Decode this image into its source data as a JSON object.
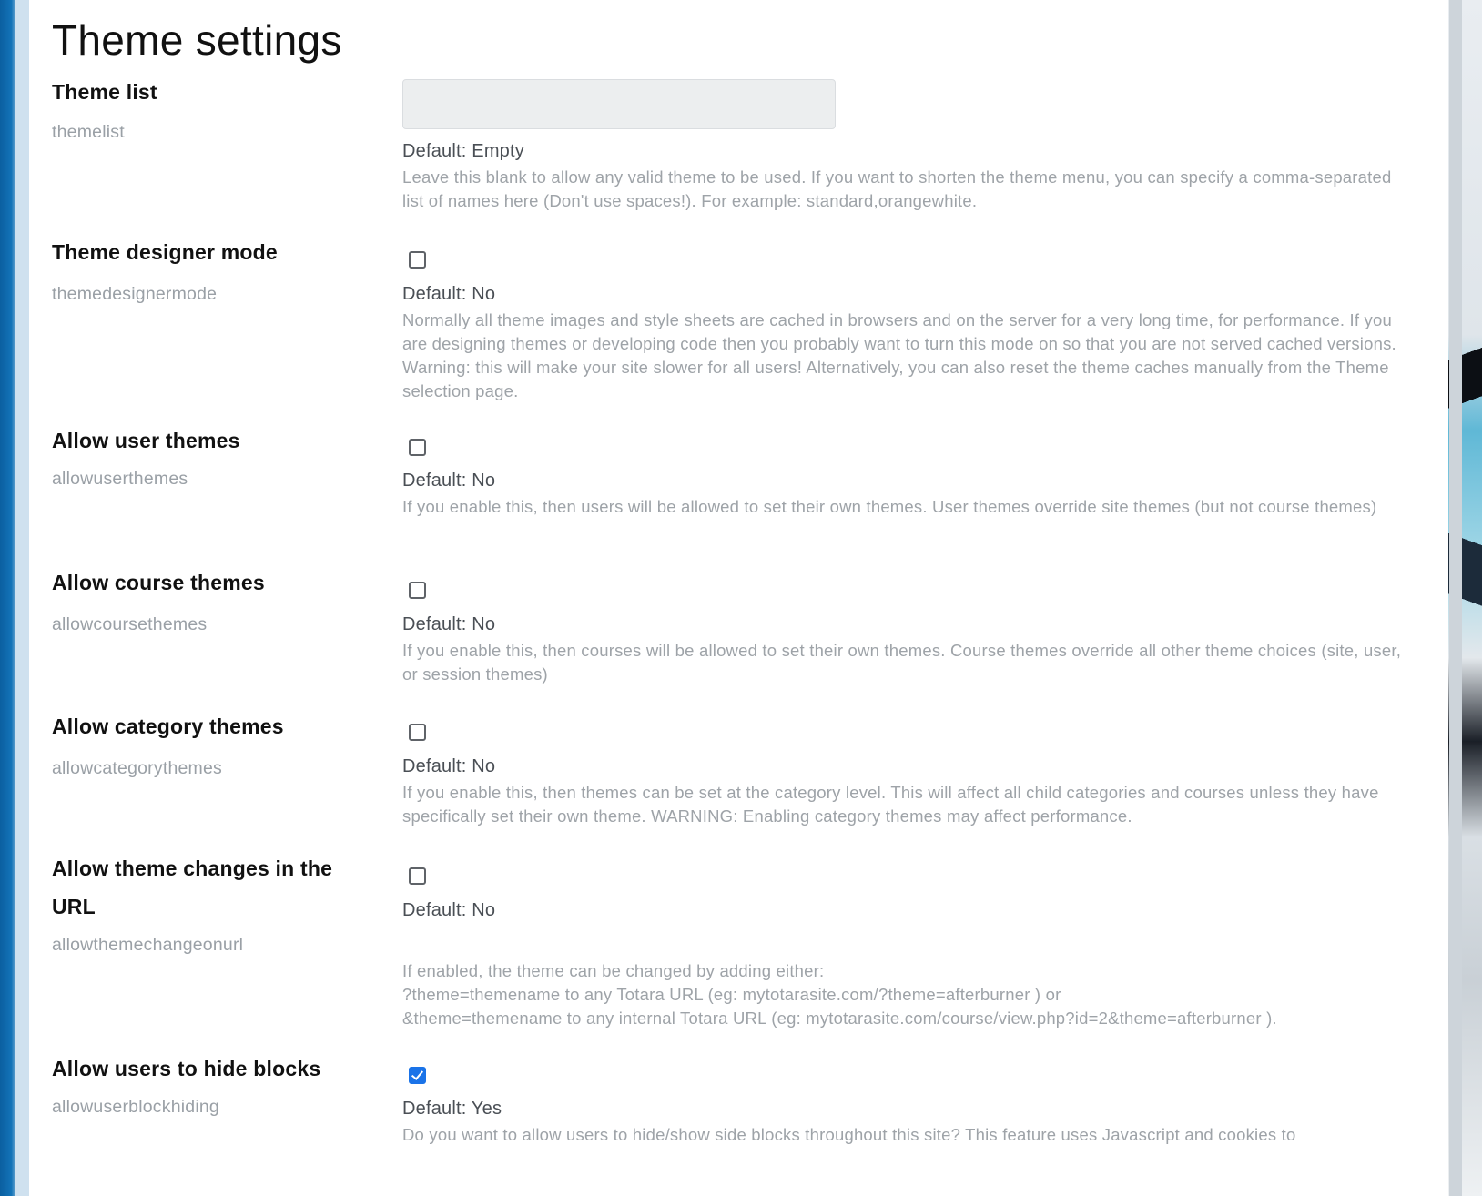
{
  "page": {
    "title": "Theme settings"
  },
  "settings": [
    {
      "title": "Theme list",
      "key": "themelist",
      "control": "text",
      "value": "",
      "default": "Default: Empty",
      "description": "Leave this blank to allow any valid theme to be used. If you want to shorten the theme menu, you can specify a comma-separated list of names here (Don't use spaces!). For example: standard,orangewhite."
    },
    {
      "title": "Theme designer mode",
      "key": "themedesignermode",
      "control": "checkbox",
      "checked": false,
      "default": "Default: No",
      "description": "Normally all theme images and style sheets are cached in browsers and on the server for a very long time, for performance. If you are designing themes or developing code then you probably want to turn this mode on so that you are not served cached versions. Warning: this will make your site slower for all users! Alternatively, you can also reset the theme caches manually from the Theme selection page."
    },
    {
      "title": "Allow user themes",
      "key": "allowuserthemes",
      "control": "checkbox",
      "checked": false,
      "default": "Default: No",
      "description": "If you enable this, then users will be allowed to set their own themes. User themes override site themes (but not course themes)"
    },
    {
      "title": "Allow course themes",
      "key": "allowcoursethemes",
      "control": "checkbox",
      "checked": false,
      "default": "Default: No",
      "description": "If you enable this, then courses will be allowed to set their own themes. Course themes override all other theme choices (site, user, or session themes)"
    },
    {
      "title": "Allow category themes",
      "key": "allowcategorythemes",
      "control": "checkbox",
      "checked": false,
      "default": "Default: No",
      "description": "If you enable this, then themes can be set at the category level. This will affect all child categories and courses unless they have specifically set their own theme. WARNING: Enabling category themes may affect performance."
    },
    {
      "title": "Allow theme changes in the URL",
      "key": "allowthemechangeonurl",
      "control": "checkbox",
      "checked": false,
      "default": "Default: No",
      "description": "If enabled, the theme can be changed by adding either:\n?theme=themename to any Totara URL (eg: mytotarasite.com/?theme=afterburner ) or\n&theme=themename to any internal Totara URL (eg: mytotarasite.com/course/view.php?id=2&theme=afterburner )."
    },
    {
      "title": "Allow users to hide blocks",
      "key": "allowuserblockhiding",
      "control": "checkbox",
      "checked": true,
      "default": "Default: Yes",
      "description": "Do you want to allow users to hide/show side blocks throughout this site? This feature uses Javascript and cookies to"
    }
  ],
  "colors": {
    "accent": "#1a73e8",
    "muted_text": "#9ea3a8",
    "input_bg": "#eceeef"
  }
}
